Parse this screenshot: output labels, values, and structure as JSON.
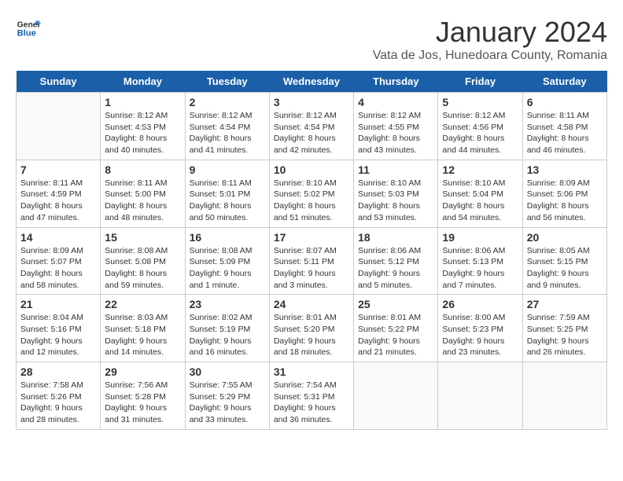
{
  "logo": {
    "line1": "General",
    "line2": "Blue"
  },
  "title": "January 2024",
  "subtitle": "Vata de Jos, Hunedoara County, Romania",
  "headers": [
    "Sunday",
    "Monday",
    "Tuesday",
    "Wednesday",
    "Thursday",
    "Friday",
    "Saturday"
  ],
  "weeks": [
    [
      {
        "day": "",
        "sunrise": "",
        "sunset": "",
        "daylight": ""
      },
      {
        "day": "1",
        "sunrise": "Sunrise: 8:12 AM",
        "sunset": "Sunset: 4:53 PM",
        "daylight": "Daylight: 8 hours and 40 minutes."
      },
      {
        "day": "2",
        "sunrise": "Sunrise: 8:12 AM",
        "sunset": "Sunset: 4:54 PM",
        "daylight": "Daylight: 8 hours and 41 minutes."
      },
      {
        "day": "3",
        "sunrise": "Sunrise: 8:12 AM",
        "sunset": "Sunset: 4:54 PM",
        "daylight": "Daylight: 8 hours and 42 minutes."
      },
      {
        "day": "4",
        "sunrise": "Sunrise: 8:12 AM",
        "sunset": "Sunset: 4:55 PM",
        "daylight": "Daylight: 8 hours and 43 minutes."
      },
      {
        "day": "5",
        "sunrise": "Sunrise: 8:12 AM",
        "sunset": "Sunset: 4:56 PM",
        "daylight": "Daylight: 8 hours and 44 minutes."
      },
      {
        "day": "6",
        "sunrise": "Sunrise: 8:11 AM",
        "sunset": "Sunset: 4:58 PM",
        "daylight": "Daylight: 8 hours and 46 minutes."
      }
    ],
    [
      {
        "day": "7",
        "sunrise": "Sunrise: 8:11 AM",
        "sunset": "Sunset: 4:59 PM",
        "daylight": "Daylight: 8 hours and 47 minutes."
      },
      {
        "day": "8",
        "sunrise": "Sunrise: 8:11 AM",
        "sunset": "Sunset: 5:00 PM",
        "daylight": "Daylight: 8 hours and 48 minutes."
      },
      {
        "day": "9",
        "sunrise": "Sunrise: 8:11 AM",
        "sunset": "Sunset: 5:01 PM",
        "daylight": "Daylight: 8 hours and 50 minutes."
      },
      {
        "day": "10",
        "sunrise": "Sunrise: 8:10 AM",
        "sunset": "Sunset: 5:02 PM",
        "daylight": "Daylight: 8 hours and 51 minutes."
      },
      {
        "day": "11",
        "sunrise": "Sunrise: 8:10 AM",
        "sunset": "Sunset: 5:03 PM",
        "daylight": "Daylight: 8 hours and 53 minutes."
      },
      {
        "day": "12",
        "sunrise": "Sunrise: 8:10 AM",
        "sunset": "Sunset: 5:04 PM",
        "daylight": "Daylight: 8 hours and 54 minutes."
      },
      {
        "day": "13",
        "sunrise": "Sunrise: 8:09 AM",
        "sunset": "Sunset: 5:06 PM",
        "daylight": "Daylight: 8 hours and 56 minutes."
      }
    ],
    [
      {
        "day": "14",
        "sunrise": "Sunrise: 8:09 AM",
        "sunset": "Sunset: 5:07 PM",
        "daylight": "Daylight: 8 hours and 58 minutes."
      },
      {
        "day": "15",
        "sunrise": "Sunrise: 8:08 AM",
        "sunset": "Sunset: 5:08 PM",
        "daylight": "Daylight: 8 hours and 59 minutes."
      },
      {
        "day": "16",
        "sunrise": "Sunrise: 8:08 AM",
        "sunset": "Sunset: 5:09 PM",
        "daylight": "Daylight: 9 hours and 1 minute."
      },
      {
        "day": "17",
        "sunrise": "Sunrise: 8:07 AM",
        "sunset": "Sunset: 5:11 PM",
        "daylight": "Daylight: 9 hours and 3 minutes."
      },
      {
        "day": "18",
        "sunrise": "Sunrise: 8:06 AM",
        "sunset": "Sunset: 5:12 PM",
        "daylight": "Daylight: 9 hours and 5 minutes."
      },
      {
        "day": "19",
        "sunrise": "Sunrise: 8:06 AM",
        "sunset": "Sunset: 5:13 PM",
        "daylight": "Daylight: 9 hours and 7 minutes."
      },
      {
        "day": "20",
        "sunrise": "Sunrise: 8:05 AM",
        "sunset": "Sunset: 5:15 PM",
        "daylight": "Daylight: 9 hours and 9 minutes."
      }
    ],
    [
      {
        "day": "21",
        "sunrise": "Sunrise: 8:04 AM",
        "sunset": "Sunset: 5:16 PM",
        "daylight": "Daylight: 9 hours and 12 minutes."
      },
      {
        "day": "22",
        "sunrise": "Sunrise: 8:03 AM",
        "sunset": "Sunset: 5:18 PM",
        "daylight": "Daylight: 9 hours and 14 minutes."
      },
      {
        "day": "23",
        "sunrise": "Sunrise: 8:02 AM",
        "sunset": "Sunset: 5:19 PM",
        "daylight": "Daylight: 9 hours and 16 minutes."
      },
      {
        "day": "24",
        "sunrise": "Sunrise: 8:01 AM",
        "sunset": "Sunset: 5:20 PM",
        "daylight": "Daylight: 9 hours and 18 minutes."
      },
      {
        "day": "25",
        "sunrise": "Sunrise: 8:01 AM",
        "sunset": "Sunset: 5:22 PM",
        "daylight": "Daylight: 9 hours and 21 minutes."
      },
      {
        "day": "26",
        "sunrise": "Sunrise: 8:00 AM",
        "sunset": "Sunset: 5:23 PM",
        "daylight": "Daylight: 9 hours and 23 minutes."
      },
      {
        "day": "27",
        "sunrise": "Sunrise: 7:59 AM",
        "sunset": "Sunset: 5:25 PM",
        "daylight": "Daylight: 9 hours and 26 minutes."
      }
    ],
    [
      {
        "day": "28",
        "sunrise": "Sunrise: 7:58 AM",
        "sunset": "Sunset: 5:26 PM",
        "daylight": "Daylight: 9 hours and 28 minutes."
      },
      {
        "day": "29",
        "sunrise": "Sunrise: 7:56 AM",
        "sunset": "Sunset: 5:28 PM",
        "daylight": "Daylight: 9 hours and 31 minutes."
      },
      {
        "day": "30",
        "sunrise": "Sunrise: 7:55 AM",
        "sunset": "Sunset: 5:29 PM",
        "daylight": "Daylight: 9 hours and 33 minutes."
      },
      {
        "day": "31",
        "sunrise": "Sunrise: 7:54 AM",
        "sunset": "Sunset: 5:31 PM",
        "daylight": "Daylight: 9 hours and 36 minutes."
      },
      {
        "day": "",
        "sunrise": "",
        "sunset": "",
        "daylight": ""
      },
      {
        "day": "",
        "sunrise": "",
        "sunset": "",
        "daylight": ""
      },
      {
        "day": "",
        "sunrise": "",
        "sunset": "",
        "daylight": ""
      }
    ]
  ]
}
